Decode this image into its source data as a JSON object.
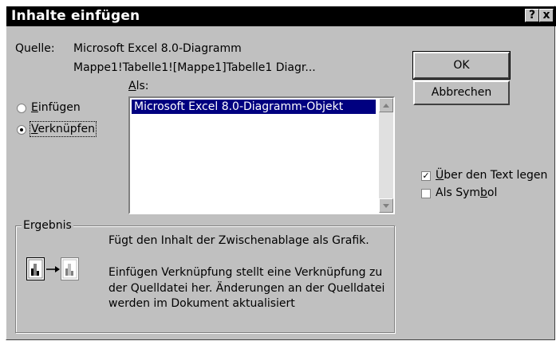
{
  "dialog": {
    "title": "Inhalte einfügen",
    "help_label": "?",
    "close_label": "x"
  },
  "source": {
    "label": "Quelle:",
    "line1": "Microsoft Excel 8.0-Diagramm",
    "line2": "Mappe1!Tabelle1![Mappe1]Tabelle1 Diagr..."
  },
  "as": {
    "label_first": "A",
    "label_rest": "ls:",
    "items": [
      "Microsoft Excel 8.0-Diagramm-Objekt"
    ]
  },
  "options": {
    "paste_first": "E",
    "paste_rest": "infügen",
    "link_first": "V",
    "link_rest": "erknüpfen",
    "paste_selected": false,
    "link_selected": true
  },
  "buttons": {
    "ok": "OK",
    "cancel": "Abbrechen"
  },
  "checkboxes": {
    "float_first": "Ü",
    "float_rest": "ber den Text legen",
    "float_checked": true,
    "symbol_pre": "Als Sym",
    "symbol_u": "b",
    "symbol_post": "ol",
    "symbol_checked": false
  },
  "result": {
    "legend": "Ergebnis",
    "line1": "Fügt den Inhalt der Zwischenablage als Grafik.",
    "line2": "Einfügen Verknüpfung stellt eine Verknüpfung zu",
    "line3": "der Quelldatei her. Änderungen an der Quelldatei",
    "line4": "werden im Dokument aktualisiert"
  },
  "icons": {
    "source_doc": "chart-document-icon",
    "arrow": "right-arrow-icon",
    "target_doc": "linked-chart-document-icon"
  }
}
